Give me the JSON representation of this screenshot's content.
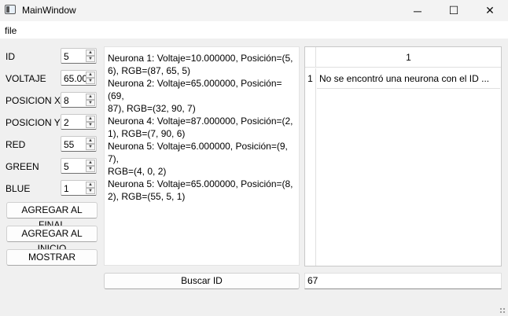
{
  "window": {
    "title": "MainWindow",
    "minimize_glyph": "─",
    "maximize_glyph": "☐",
    "close_glyph": "✕"
  },
  "menu": {
    "file": "file"
  },
  "form": {
    "id": {
      "label": "ID",
      "value": "5"
    },
    "voltaje": {
      "label": "VOLTAJE",
      "value": "65.00"
    },
    "posicion_x": {
      "label": "POSICION X",
      "value": "8"
    },
    "posicion_y": {
      "label": "POSICION Y",
      "value": "2"
    },
    "red": {
      "label": "RED",
      "value": "55"
    },
    "green": {
      "label": "GREEN",
      "value": "5"
    },
    "blue": {
      "label": "BLUE",
      "value": "1"
    }
  },
  "buttons": {
    "agregar_final": "AGREGAR AL FINAL",
    "agregar_inicio": "AGREGAR AL INICIO",
    "mostrar": "MOSTRAR",
    "buscar_id": "Buscar ID"
  },
  "output": {
    "lines": [
      "Neurona 1: Voltaje=10.000000, Posición=(5,",
      "6), RGB=(87, 65, 5)",
      "Neurona 2: Voltaje=65.000000, Posición=(69,",
      "87), RGB=(32, 90, 7)",
      "Neurona 4: Voltaje=87.000000, Posición=(2,",
      "1), RGB=(7, 90, 6)",
      "Neurona 5: Voltaje=6.000000, Posición=(9, 7),",
      "RGB=(4, 0, 2)",
      "Neurona 5: Voltaje=65.000000, Posición=(8,",
      "2), RGB=(55, 5, 1)"
    ]
  },
  "table": {
    "column_header": "1",
    "row_header": "1",
    "cell": "No se encontró una neurona con el ID ..."
  },
  "search": {
    "value": "67"
  },
  "icons": {
    "spin_up": "▲",
    "spin_down": "▼"
  }
}
